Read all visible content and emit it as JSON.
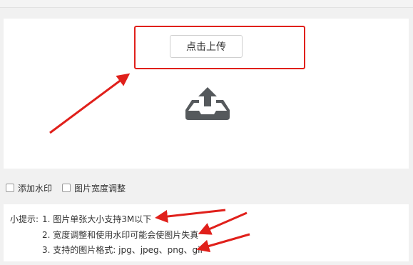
{
  "upload": {
    "button_label": "点击上传",
    "icon": "upload-tray-icon"
  },
  "options": [
    {
      "label": "添加水印",
      "checked": false
    },
    {
      "label": "图片宽度调整",
      "checked": false
    }
  ],
  "tips": {
    "prefix": "小提示:",
    "items": [
      "1. 图片单张大小支持3M以下",
      "2. 宽度调整和使用水印可能会使图片失真",
      "3. 支持的图片格式: jpg、jpeg、png、gif"
    ]
  },
  "colors": {
    "annotation_red": "#e0201b",
    "panel_bg": "#ffffff",
    "page_bg": "#f1f1f1",
    "icon_gray": "#55595c"
  }
}
